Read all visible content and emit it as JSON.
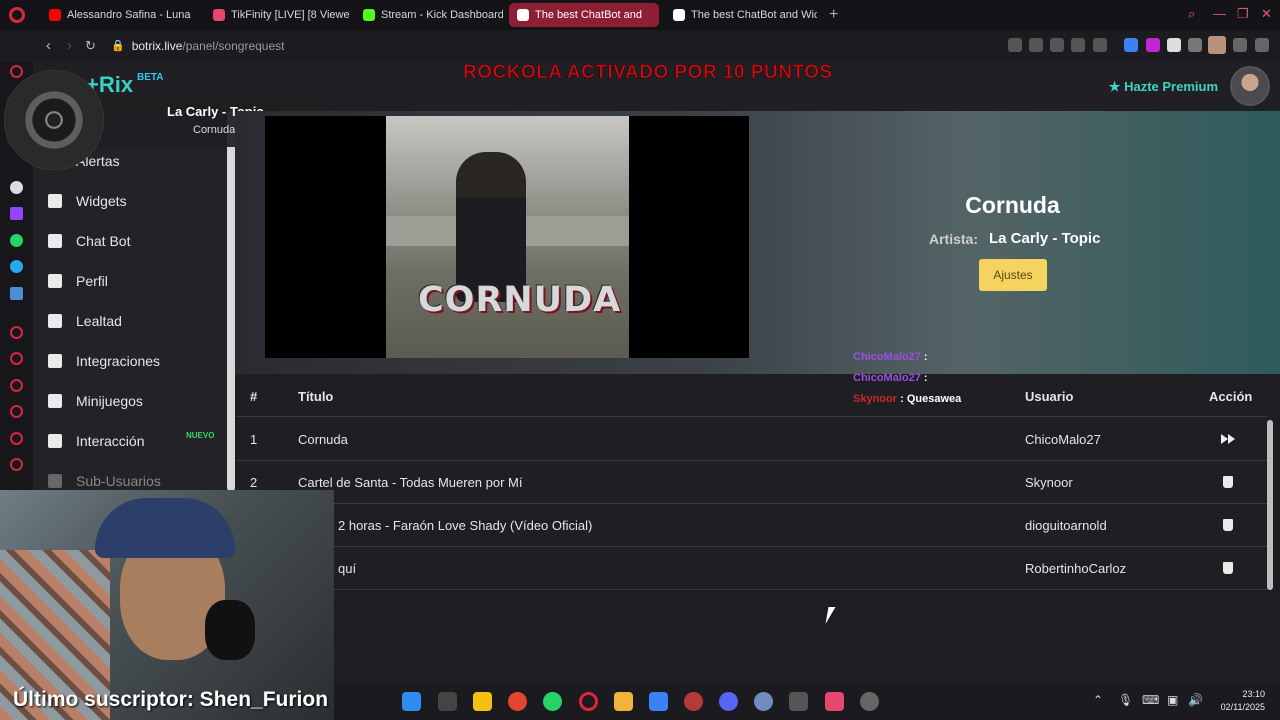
{
  "browser": {
    "tabs": [
      {
        "label": "Alessandro Safina - Luna",
        "color": "#ff0000"
      },
      {
        "label": "TikFinity [LIVE] [8 Viewer",
        "color": "#e5476d"
      },
      {
        "label": "Stream - Kick Dashboard",
        "color": "#53fc18"
      },
      {
        "label": "The best ChatBot and",
        "color": "#ffffff",
        "active": true
      },
      {
        "label": "The best ChatBot and Wic",
        "color": "#ffffff"
      }
    ],
    "url_host": "botrix.live",
    "url_path": "/panel/songrequest"
  },
  "header": {
    "banner": "ROCKOLA ACTIVADO POR 10 PUNTOS",
    "premium_label": "Hazte Premium"
  },
  "sidebar": {
    "brand": "+Rix",
    "beta": "BETA",
    "items": [
      {
        "label": "Alertas",
        "icon": "bell-icon"
      },
      {
        "label": "Widgets",
        "icon": "grid-icon"
      },
      {
        "label": "Chat Bot",
        "icon": "robot-icon"
      },
      {
        "label": "Perfil",
        "icon": "id-card-icon"
      },
      {
        "label": "Lealtad",
        "icon": "trophy-icon"
      },
      {
        "label": "Integraciones",
        "icon": "puzzle-icon"
      },
      {
        "label": "Minijuegos",
        "icon": "gamepad-icon"
      },
      {
        "label": "Interacción",
        "icon": "music-icon"
      },
      {
        "label": "Sub-Usuarios",
        "icon": "users-icon"
      }
    ],
    "nuevo_badge": "NUEVO"
  },
  "now_playing": {
    "artist": "La Carly - Topic",
    "title": "Cornuda"
  },
  "hero": {
    "thumbnail_text": "CORNUDA",
    "song_title": "Cornuda",
    "artist_label": "Artista:",
    "artist_value": "La Carly - Topic",
    "settings_button": "Ajustes"
  },
  "table": {
    "headers": {
      "num": "#",
      "title": "Título",
      "user": "Usuario",
      "action": "Acción"
    },
    "rows": [
      {
        "num": "1",
        "title": "Cornuda",
        "user": "ChicoMalo27",
        "action": "skip-icon"
      },
      {
        "num": "2",
        "title": "Cartel de Santa - Todas Mueren por Mí",
        "user": "Skynoor",
        "action": "trash-icon"
      },
      {
        "num": "",
        "title": "2 horas - Faraón Love Shady (Vídeo Oficial)",
        "user": "dioguitoarnold",
        "action": "trash-icon"
      },
      {
        "num": "",
        "title": "quí",
        "user": "RobertinhoCarloz",
        "action": "trash-icon"
      }
    ]
  },
  "chat_overlay": [
    {
      "user": "ChicoMalo27",
      "sep": ":",
      "message": ""
    },
    {
      "user": "ChicoMalo27",
      "sep": ":",
      "message": ""
    },
    {
      "user": "Skynoor",
      "sep": ":",
      "message": "Quesawea"
    }
  ],
  "webcam": {
    "last_subscriber": "Último suscriptor: Shen_Furion"
  },
  "taskbar": {
    "time": "23:10",
    "date": "02/11/2025"
  }
}
